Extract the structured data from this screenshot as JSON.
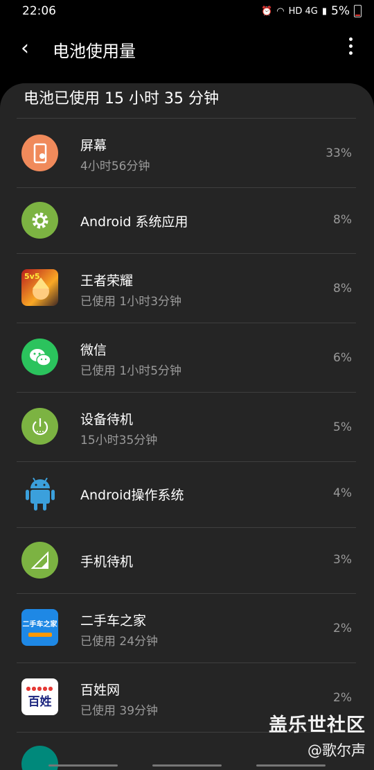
{
  "status": {
    "time": "22:06",
    "network": "HD 4G",
    "battery": "5%"
  },
  "header": {
    "title": "电池使用量"
  },
  "summary": "电池已使用 15 小时 35 分钟",
  "apps": [
    {
      "name": "屏幕",
      "sub": "4小时56分钟",
      "pct": "33%",
      "icon": "screen-icon"
    },
    {
      "name": "Android 系统应用",
      "sub": "",
      "pct": "8%",
      "icon": "gear-icon"
    },
    {
      "name": "王者荣耀",
      "sub": "已使用 1小时3分钟",
      "pct": "8%",
      "icon": "honor-of-kings-icon"
    },
    {
      "name": "微信",
      "sub": "已使用 1小时5分钟",
      "pct": "6%",
      "icon": "wechat-icon"
    },
    {
      "name": "设备待机",
      "sub": "15小时35分钟",
      "pct": "5%",
      "icon": "power-icon"
    },
    {
      "name": "Android操作系统",
      "sub": "",
      "pct": "4%",
      "icon": "android-icon"
    },
    {
      "name": "手机待机",
      "sub": "",
      "pct": "3%",
      "icon": "signal-icon"
    },
    {
      "name": "二手车之家",
      "sub": "已使用 24分钟",
      "pct": "2%",
      "icon": "used-car-home-icon",
      "logo_text": "二手车之家"
    },
    {
      "name": "百姓网",
      "sub": "已使用 39分钟",
      "pct": "2%",
      "icon": "baixing-icon",
      "logo_text": "百姓"
    }
  ],
  "watermark": {
    "line1": "盖乐世社区",
    "line2": "@歌尔声"
  }
}
